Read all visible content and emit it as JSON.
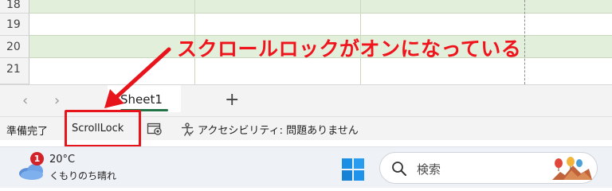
{
  "grid": {
    "rows": [
      {
        "number": "18",
        "shaded": true
      },
      {
        "number": "19",
        "shaded": false
      },
      {
        "number": "20",
        "shaded": true
      },
      {
        "number": "21",
        "shaded": false
      }
    ]
  },
  "sheet_tabs": {
    "prev_arrow": "‹",
    "next_arrow": "›",
    "active_tab": "Sheet1",
    "add_sheet": "+"
  },
  "status_bar": {
    "ready": "準備完了",
    "scroll_lock": "ScrollLock",
    "macro_icon": "macro-record-icon",
    "accessibility_icon": "accessibility-icon",
    "accessibility": "アクセシビリティ: 問題ありません"
  },
  "annotation": {
    "text": "スクロールロックがオンになっている",
    "color": "#f0131c"
  },
  "taskbar": {
    "weather": {
      "badge": "1",
      "temperature": "20°C",
      "condition": "くもりのち晴れ",
      "icon": "cloud-icon"
    },
    "start_icon": "windows-start-icon",
    "search": {
      "placeholder": "検索",
      "icon": "search-icon"
    }
  },
  "colors": {
    "accent_green": "#217346",
    "highlight_red": "#e8141c",
    "row_shade": "#e2efda"
  }
}
